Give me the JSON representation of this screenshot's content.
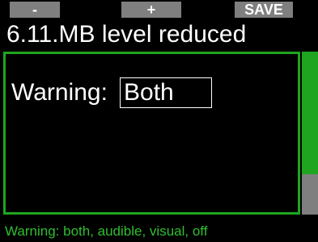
{
  "softkeys": {
    "minus": "-",
    "plus": "+",
    "save": "SAVE"
  },
  "title": "6.11.MB level reduced",
  "setting": {
    "label": "Warning:",
    "value": "Both"
  },
  "scrollbar": {
    "thumb_fraction": 0.75,
    "accent_color": "#1fa51f",
    "track_color": "#7f7f7f"
  },
  "hint": "Warning: both, audible, visual, off"
}
